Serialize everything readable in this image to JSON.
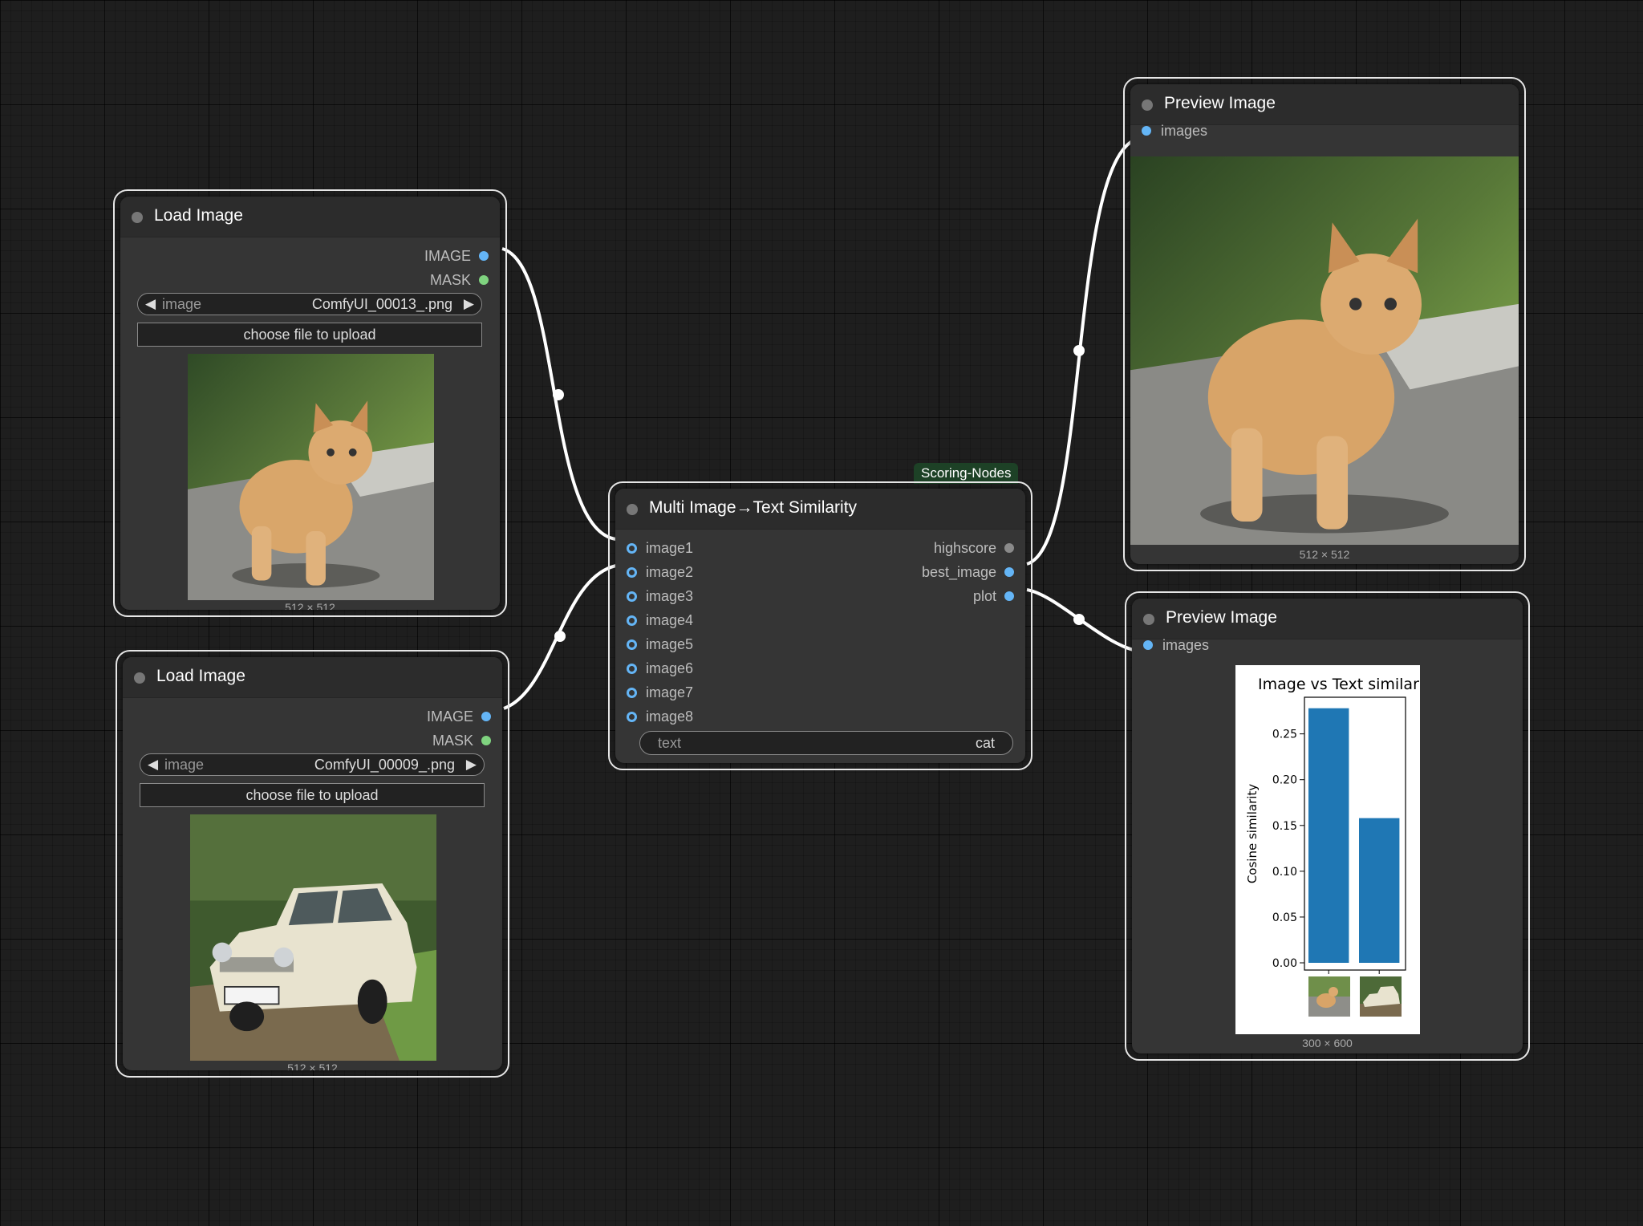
{
  "canvas": {
    "background": "#1e1e1e",
    "wire_color": "#ffffff",
    "slot_blue": "#64b5f6",
    "slot_green": "#7fd37f"
  },
  "load_image_1": {
    "title": "Load Image",
    "outputs": [
      "IMAGE",
      "MASK"
    ],
    "image_label": "image",
    "image_value": "ComfyUI_00013_.png",
    "upload_label": "choose file to upload",
    "size_caption": "512 × 512",
    "thumb_icon": "cat-photo"
  },
  "load_image_2": {
    "title": "Load Image",
    "outputs": [
      "IMAGE",
      "MASK"
    ],
    "image_label": "image",
    "image_value": "ComfyUI_00009_.png",
    "upload_label": "choose file to upload",
    "size_caption": "512 × 512",
    "thumb_icon": "car-photo"
  },
  "similarity": {
    "badge": "Scoring-Nodes",
    "title": "Multi Image→Text Similarity",
    "inputs": [
      "image1",
      "image2",
      "image3",
      "image4",
      "image5",
      "image6",
      "image7",
      "image8"
    ],
    "outputs": [
      "highscore",
      "best_image",
      "plot"
    ],
    "text_label": "text",
    "text_value": "cat"
  },
  "preview_1": {
    "title": "Preview Image",
    "input": "images",
    "size_caption": "512 × 512",
    "image_icon": "cat-photo"
  },
  "preview_2": {
    "title": "Preview Image",
    "input": "images",
    "size_caption": "300 × 600"
  },
  "chart_data": {
    "type": "bar",
    "title": "Image vs Text similar",
    "ylabel": "Cosine similarity",
    "xlabel": "",
    "categories": [
      "cat-image",
      "car-image"
    ],
    "values": [
      0.278,
      0.158
    ],
    "ylim": [
      0,
      0.29
    ],
    "yticks": [
      "0.00",
      "0.05",
      "0.10",
      "0.15",
      "0.20",
      "0.25"
    ],
    "bar_color": "#1f77b4",
    "grid": false
  }
}
